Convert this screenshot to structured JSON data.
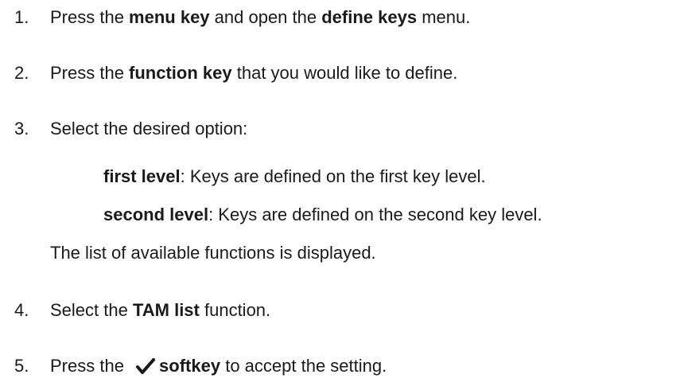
{
  "steps": [
    {
      "number": "1.",
      "parts": [
        "Press the ",
        "menu key",
        " and open the ",
        "define keys",
        " menu."
      ]
    },
    {
      "number": "2.",
      "parts": [
        "Press the ",
        "function key",
        " that you would like to define."
      ]
    },
    {
      "number": "3.",
      "text": "Select the desired option:",
      "options": [
        {
          "term": "first level",
          "desc": ": Keys are defined on the first key level."
        },
        {
          "term": "second level",
          "desc": ": Keys are defined on the second key level."
        }
      ],
      "note": "The list of available functions is displayed."
    },
    {
      "number": "4.",
      "parts": [
        "Select the ",
        "TAM list",
        " function."
      ]
    },
    {
      "number": "5.",
      "parts": [
        "Press the ",
        "softkey",
        " to accept the setting."
      ],
      "icon": "checkmark-icon"
    }
  ]
}
